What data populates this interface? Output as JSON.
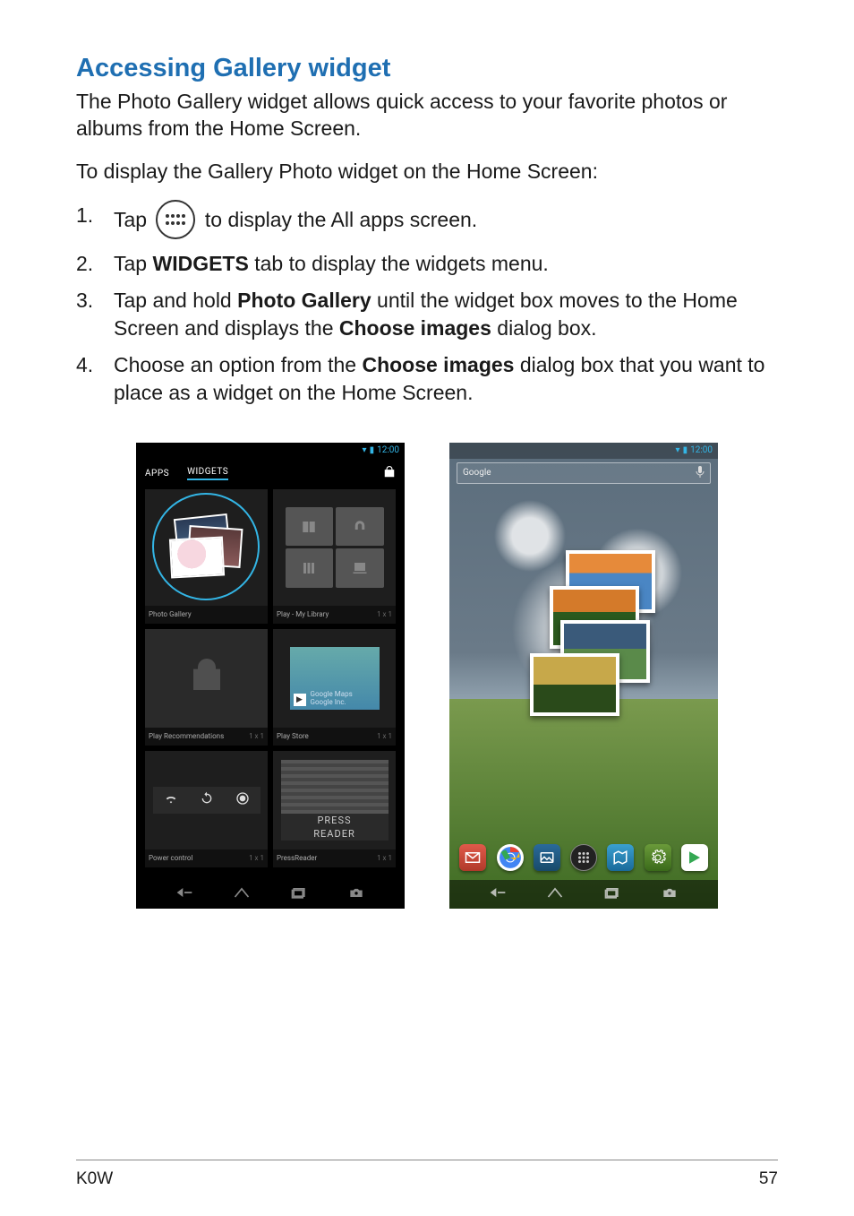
{
  "heading": "Accessing Gallery widget",
  "intro": "The Photo Gallery widget allows quick access to your favorite photos or albums from the Home Screen.",
  "lead": "To display the Gallery Photo widget on the Home Screen:",
  "steps": {
    "s1a": "Tap ",
    "s1b": " to display the All apps screen.",
    "s2a": "Tap ",
    "s2b": "WIDGETS",
    "s2c": " tab to display the widgets menu.",
    "s3a": "Tap and hold ",
    "s3b": "Photo Gallery",
    "s3c": " until the widget box moves to the Home Screen and displays the ",
    "s3d": "Choose images",
    "s3e": " dialog box.",
    "s4a": "Choose an option from the ",
    "s4b": "Choose images",
    "s4c": " dialog box that you want to place as a widget on the Home Screen."
  },
  "screenshot1": {
    "status_time": "12:00",
    "tab_apps": "APPS",
    "tab_widgets": "WIDGETS",
    "widgets": {
      "photo_gallery": {
        "label": "Photo Gallery",
        "size": ""
      },
      "play_library": {
        "label": "Play - My Library",
        "size": "1 x 1"
      },
      "play_recs": {
        "label": "Play Recommendations",
        "size": "1 x 1"
      },
      "play_store": {
        "label": "Play Store",
        "size": "1 x 1",
        "inner1": "Google Maps",
        "inner2": "Google Inc."
      },
      "power_control": {
        "label": "Power control",
        "size": "1 x 1"
      },
      "press_reader": {
        "label": "PressReader",
        "size": "1 x 1",
        "brand1": "PRESS",
        "brand2": "READER"
      }
    }
  },
  "screenshot2": {
    "status_time": "12:00",
    "search_placeholder": "Google"
  },
  "footer": {
    "model": "K0W",
    "page": "57"
  }
}
